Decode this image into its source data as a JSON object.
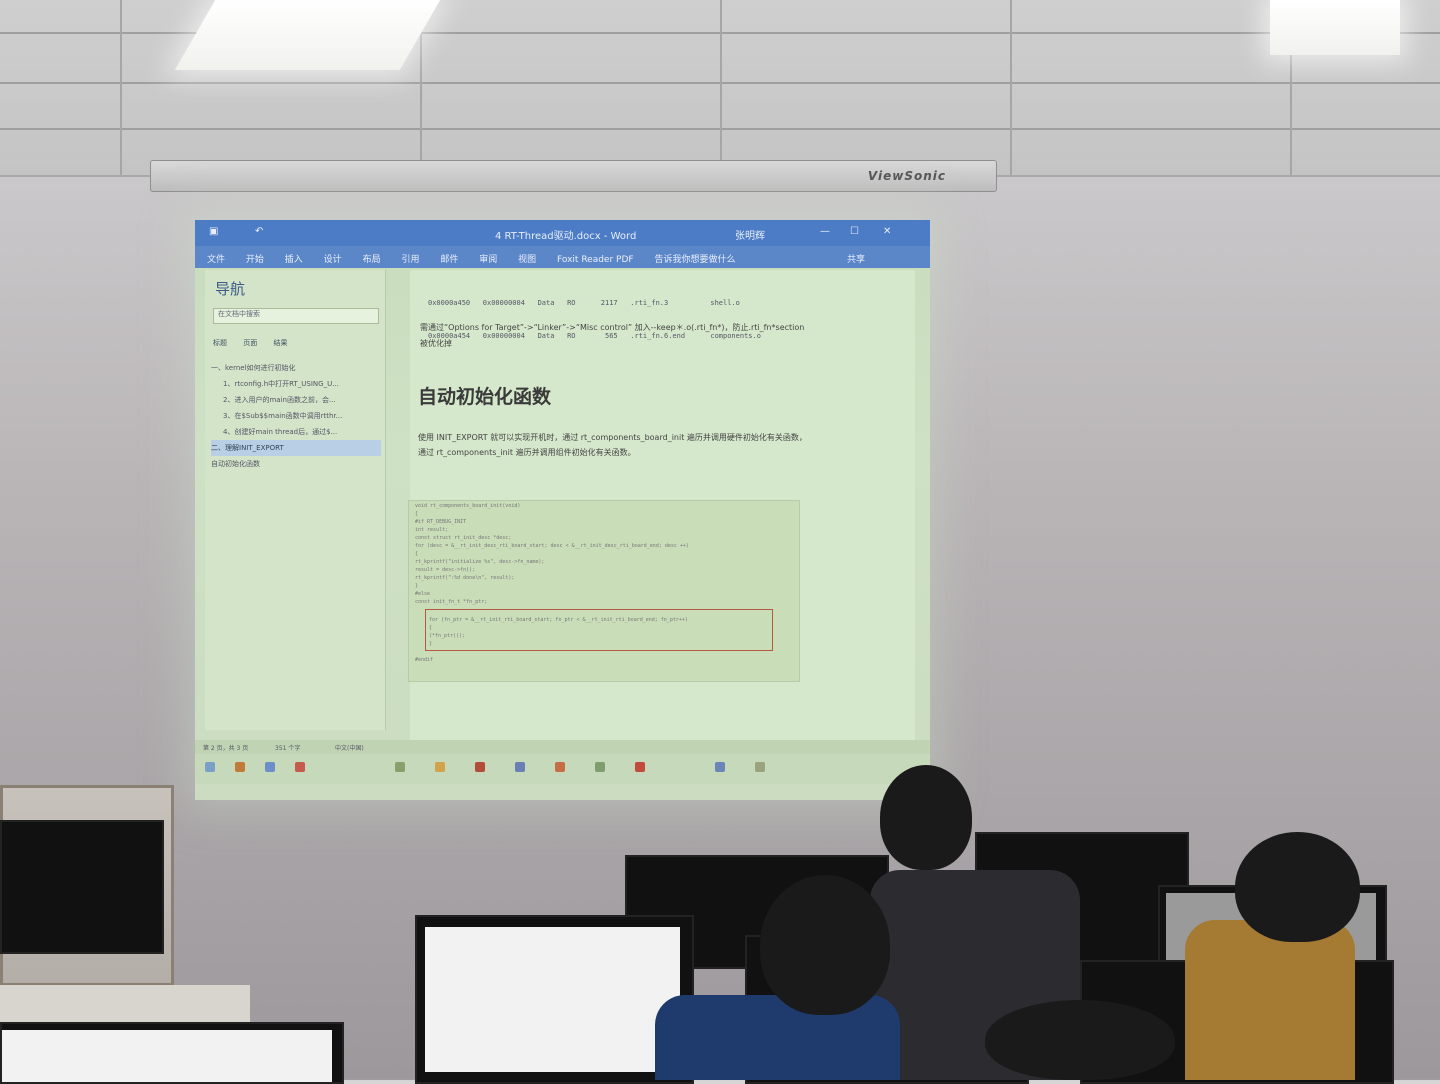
{
  "projector": {
    "brand": "ViewSonic"
  },
  "word": {
    "window_title": "4 RT-Thread驱动.docx - Word",
    "user": "张明辉",
    "ribbon_tabs": [
      "文件",
      "开始",
      "插入",
      "设计",
      "布局",
      "引用",
      "邮件",
      "审阅",
      "视图",
      "Foxit Reader PDF",
      "告诉我你想要做什么"
    ],
    "share": "共享",
    "nav": {
      "title": "导航",
      "search_placeholder": "在文档中搜索",
      "tabs": [
        "标题",
        "页面",
        "结果"
      ],
      "items": [
        "一、kernel如何进行初始化",
        "1、rtconfig.h中打开RT_USING_U...",
        "2、进入用户的main函数之前，会...",
        "3、在$Sub$$main函数中调用rtthr...",
        "4、创建好main thread后，通过$...",
        "二、理解INIT_EXPORT",
        "自动初始化函数"
      ],
      "selected_index": 5
    },
    "doc": {
      "table_rows": [
        "0x0000a450   0x00000004   Data   RO      2117   .rti_fn.3          shell.o",
        "0x0000a454   0x00000004   Data   RO       565   .rti_fn.6.end      components.o"
      ],
      "intro_text": "需通过“Options for Target”->“Linker”->“Misc control” 加入--keep＊.o(.rti_fn*)，防止.rti_fn*section 被优化掉",
      "heading": "自动初始化函数",
      "paragraph": "使用 INIT_EXPORT 就可以实现开机时，通过 rt_components_board_init 遍历并调用硬件初始化有关函数，通过 rt_components_init 遍历并调用组件初始化有关函数。",
      "code_lines": [
        "void rt_components_board_init(void)",
        "{",
        "#if RT_DEBUG_INIT",
        "    int result;",
        "    const struct rt_init_desc *desc;",
        "    for (desc = &__rt_init_desc_rti_board_start; desc < &__rt_init_desc_rti_board_end; desc ++)",
        "    {",
        "        rt_kprintf(\"initialize %s\", desc->fn_name);",
        "        result = desc->fn();",
        "        rt_kprintf(\":%d done\\n\", result);",
        "    }",
        "#else",
        "    const init_fn_t *fn_ptr;",
        "    for (fn_ptr = &__rt_init_rti_board_start; fn_ptr < &__rt_init_rti_board_end; fn_ptr++)",
        "    {",
        "        (*fn_ptr)();",
        "    }",
        "#endif"
      ]
    },
    "status": {
      "page": "第 2 页，共 3 页",
      "words": "351 个字",
      "lang": "中文(中国)"
    }
  }
}
